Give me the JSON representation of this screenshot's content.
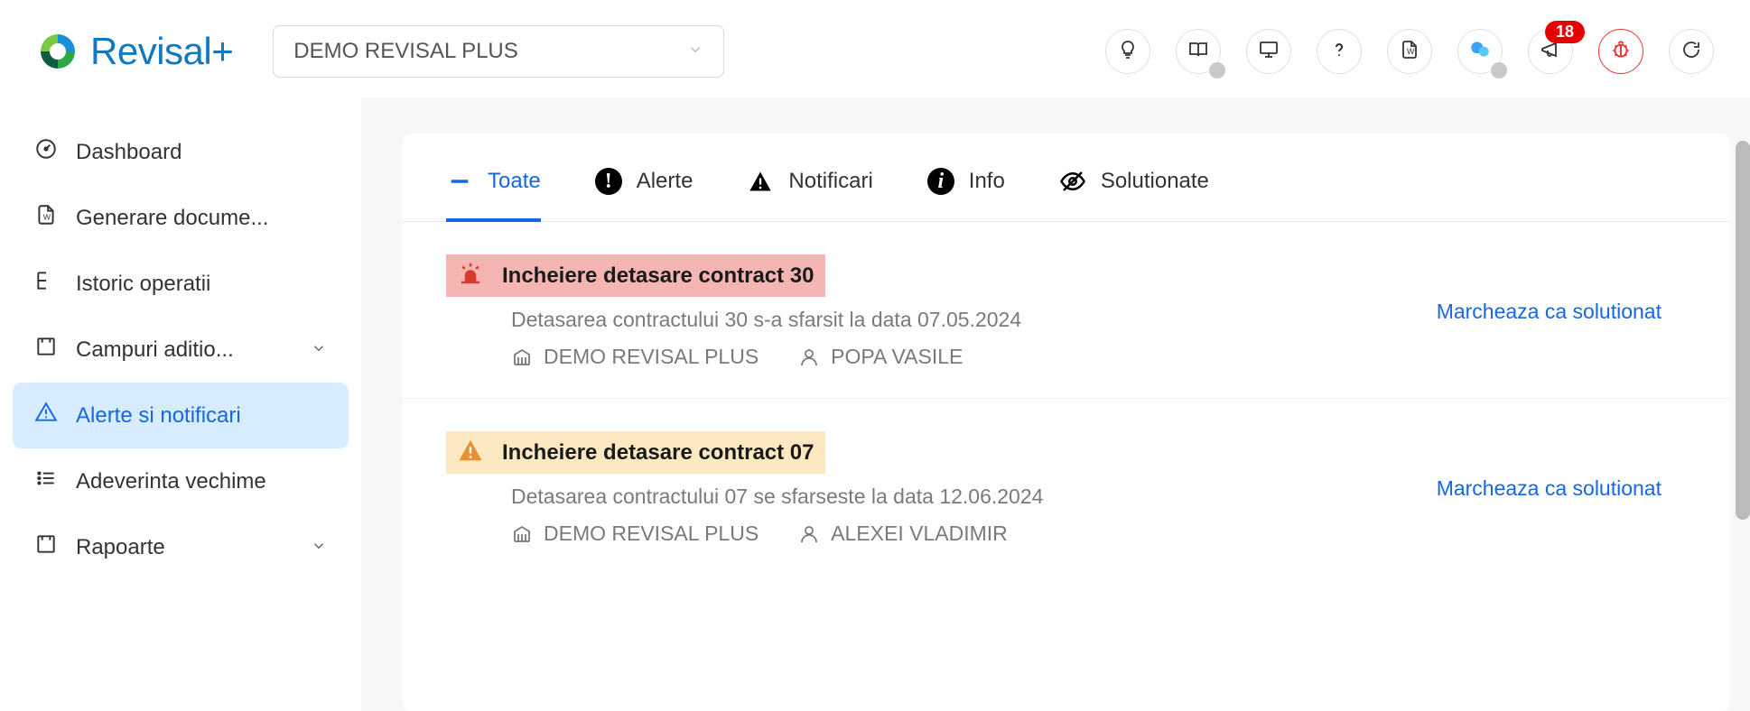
{
  "header": {
    "brand": "Revisal+",
    "company_selected": "DEMO REVISAL PLUS",
    "notifications_badge": "18"
  },
  "sidebar": {
    "items": [
      {
        "label": "Dashboard"
      },
      {
        "label": "Generare docume..."
      },
      {
        "label": "Istoric operatii"
      },
      {
        "label": "Campuri aditio...",
        "expandable": true
      },
      {
        "label": "Alerte si notificari",
        "active": true
      },
      {
        "label": "Adeverinta vechime"
      },
      {
        "label": "Rapoarte",
        "expandable": true
      }
    ]
  },
  "tabs": {
    "items": [
      {
        "label": "Toate"
      },
      {
        "label": "Alerte"
      },
      {
        "label": "Notificari"
      },
      {
        "label": "Info"
      },
      {
        "label": "Solutionate"
      }
    ]
  },
  "list": {
    "action_label": "Marcheaza ca solutionat",
    "items": [
      {
        "severity": "red",
        "title": "Incheiere detasare contract 30",
        "desc": "Detasarea contractului 30 s-a sfarsit la data 07.05.2024",
        "company": "DEMO REVISAL PLUS",
        "person": "POPA VASILE"
      },
      {
        "severity": "yellow",
        "title": "Incheiere detasare contract 07",
        "desc": "Detasarea contractului 07 se sfarseste la data 12.06.2024",
        "company": "DEMO REVISAL PLUS",
        "person": "ALEXEI VLADIMIR"
      }
    ]
  }
}
